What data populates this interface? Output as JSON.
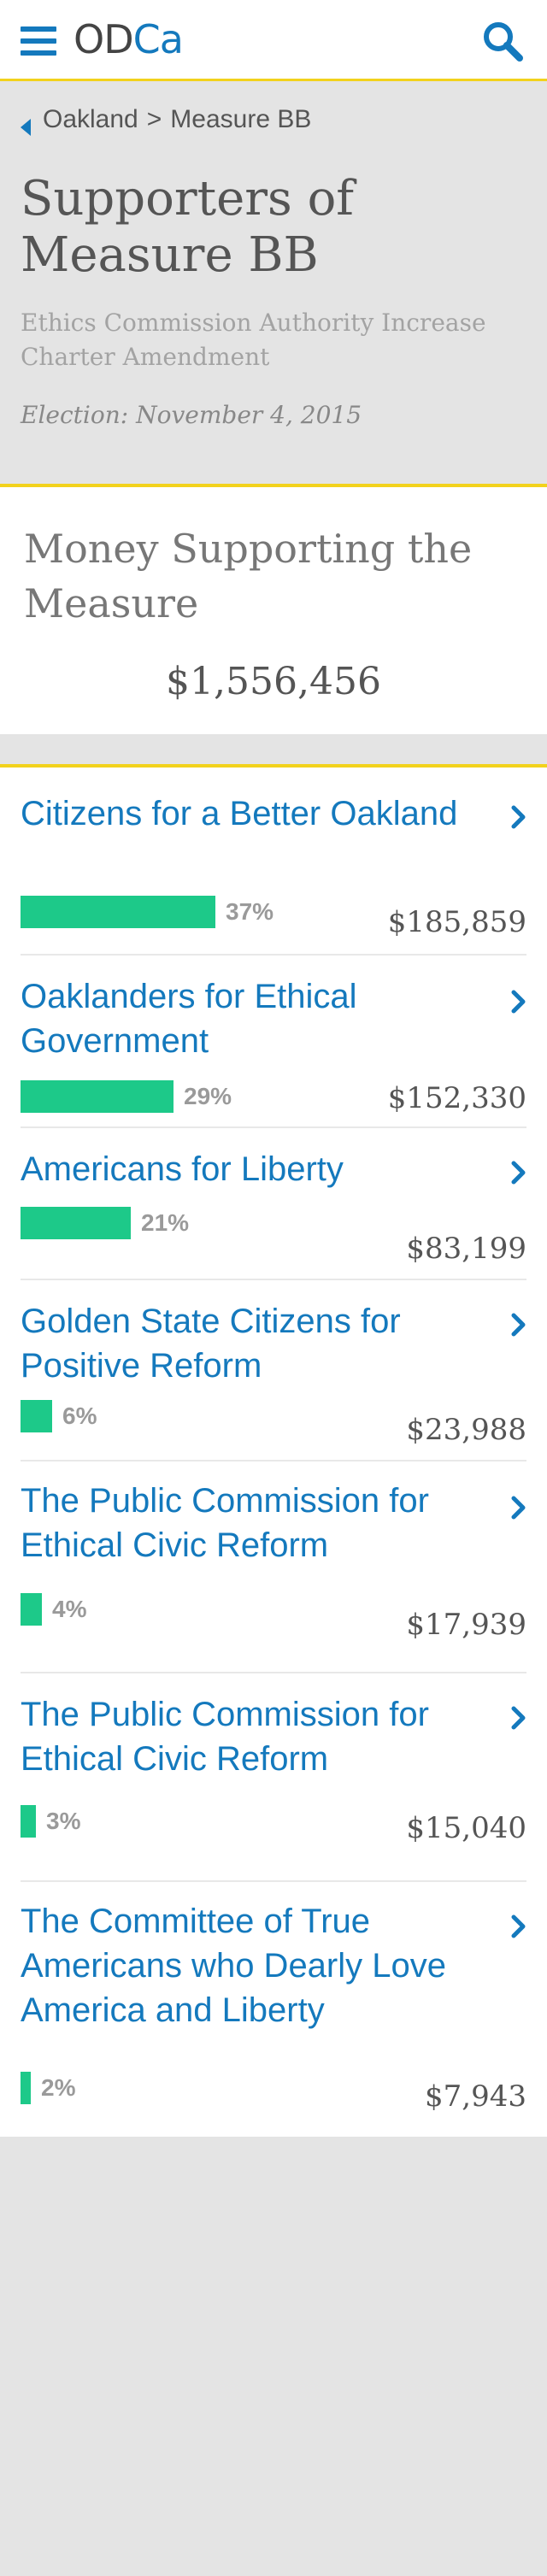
{
  "app": {
    "logo_od": "OD",
    "logo_ca": "Ca",
    "menu_icon": "hamburger-menu-icon",
    "search_icon": "search-icon",
    "accent_color": "#1479bd",
    "highlight_color": "#f2d21c",
    "bar_color": "#1dc989"
  },
  "breadcrumb": {
    "back_icon": "chevron-left-icon",
    "parent": "Oakland",
    "separator": ">",
    "current": "Measure BB"
  },
  "header": {
    "title": "Supporters of Measure BB",
    "subtitle": "Ethics Commission Authority Increase Charter Amendment",
    "election_label": "Election:",
    "election_date": "November 4, 2015"
  },
  "summary": {
    "title": "Money Supporting the Measure",
    "total": "$1,556,456"
  },
  "supporters": [
    {
      "name": "Citizens for a Better Oakland",
      "percent_label": "37%",
      "share": 37,
      "amount": "$185,859"
    },
    {
      "name": "Oaklanders for Ethical Government",
      "percent_label": "29%",
      "share": 29,
      "amount": "$152,330"
    },
    {
      "name": "Americans for Liberty",
      "percent_label": "21%",
      "share": 21,
      "amount": "$83,199"
    },
    {
      "name": "Golden State Citizens for Positive Reform",
      "percent_label": "6%",
      "share": 6,
      "amount": "$23,988"
    },
    {
      "name": "The Public Commission for Ethical Civic Reform",
      "percent_label": "4%",
      "share": 4,
      "amount": "$17,939"
    },
    {
      "name": "The Public Commission for Ethical Civic Reform",
      "percent_label": "3%",
      "share": 3,
      "amount": "$15,040"
    },
    {
      "name": "The Committee of True Americans who Dearly Love America and Liberty",
      "percent_label": "2%",
      "share": 2,
      "amount": "$7,943"
    }
  ]
}
